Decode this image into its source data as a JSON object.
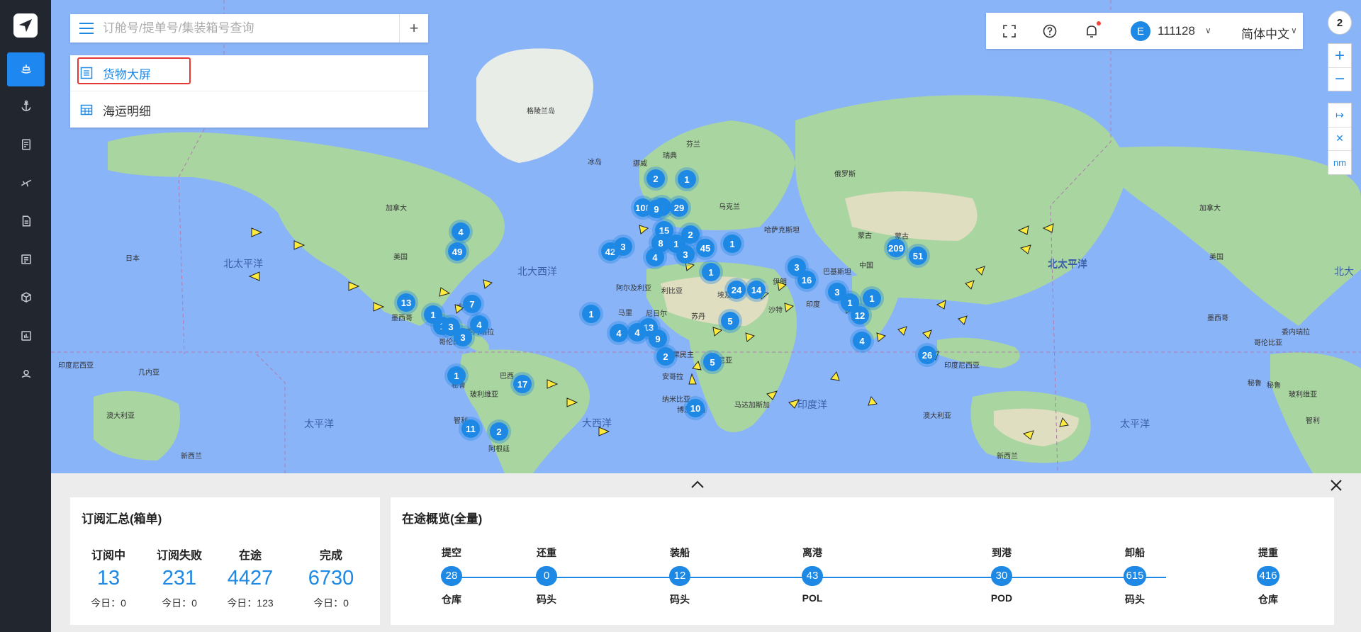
{
  "search": {
    "placeholder": "订舱号/提单号/集装箱号查询"
  },
  "menu": {
    "items": [
      {
        "label": "货物大屏",
        "selected": true
      },
      {
        "label": "海运明细",
        "selected": false
      }
    ]
  },
  "toolbar": {
    "avatar_initial": "E",
    "username": "111128",
    "language": "简体中文"
  },
  "map_controls": {
    "badge": "2",
    "zoom_in": "+",
    "zoom_out": "−",
    "unit_label": "nm"
  },
  "map": {
    "ocean_labels": [
      "北太平洋",
      "北大西洋",
      "大西洋",
      "太平洋",
      "印度洋",
      "北太平洋",
      "北太平洋",
      "北大",
      "太平洋"
    ],
    "land_labels": [
      "格陵兰岛",
      "加拿大",
      "美国",
      "日本",
      "墨西哥",
      "巴西",
      "秘鲁",
      "玻利维亚",
      "智利",
      "阿根廷",
      "澳大利亚",
      "新西兰",
      "印度尼西亚",
      "几内亚",
      "俄罗斯",
      "中国",
      "蒙古",
      "哈萨克斯坦",
      "印度",
      "伊朗",
      "埃及",
      "阿尔及利亚",
      "利比亚",
      "马里",
      "尼日尔",
      "苏丹",
      "刚果民主",
      "坦桑尼亚",
      "安哥拉",
      "纳米比亚",
      "博茨瓦纳",
      "马达加斯加",
      "沙特",
      "冰岛",
      "芬兰",
      "瑞典",
      "挪威",
      "乌克兰",
      "巴基斯坦",
      "哥伦比亚",
      "委内瑞拉",
      "古巴",
      "加拿大",
      "墨西哥",
      "美国",
      "蒙古",
      "印度尼西亚",
      "澳大利亚",
      "新西兰",
      "秘鲁",
      "哥伦比亚",
      "委内瑞拉",
      "玻利维亚",
      "秘鲁",
      "智利"
    ],
    "clusters": [
      "2",
      "1",
      "108",
      "4",
      "29",
      "4",
      "49",
      "15",
      "2",
      "42",
      "3",
      "8",
      "1",
      "45",
      "1",
      "4",
      "3",
      "209",
      "51",
      "1",
      "3",
      "16",
      "24",
      "14",
      "13",
      "7",
      "1",
      "1",
      "3",
      "4",
      "3",
      "3",
      "1",
      "12",
      "1",
      "5",
      "1",
      "4",
      "13",
      "4",
      "9",
      "2",
      "5",
      "4",
      "26",
      "1",
      "17",
      "10",
      "11",
      "2",
      "9"
    ]
  },
  "subscription_summary": {
    "title": "订阅汇总(箱单)",
    "today_prefix": "今日：",
    "stats": [
      {
        "label": "订阅中",
        "value": "13",
        "today": "今日：0"
      },
      {
        "label": "订阅失败",
        "value": "231",
        "today": "今日：0"
      },
      {
        "label": "在途",
        "value": "4427",
        "today": "今日：123"
      },
      {
        "label": "完成",
        "value": "6730",
        "today": "今日：0"
      }
    ]
  },
  "transit_overview": {
    "title": "在途概览(全量)",
    "steps": [
      {
        "label": "提空",
        "value": "28",
        "sub": "仓库"
      },
      {
        "label": "还重",
        "value": "0",
        "sub": "码头"
      },
      {
        "label": "装船",
        "value": "12",
        "sub": "码头"
      },
      {
        "label": "离港",
        "value": "43",
        "sub": "POL"
      },
      {
        "label": "到港",
        "value": "30",
        "sub": "POD"
      },
      {
        "label": "卸船",
        "value": "615",
        "sub": "码头"
      },
      {
        "label": "提重",
        "value": "416",
        "sub": "仓库"
      }
    ]
  }
}
